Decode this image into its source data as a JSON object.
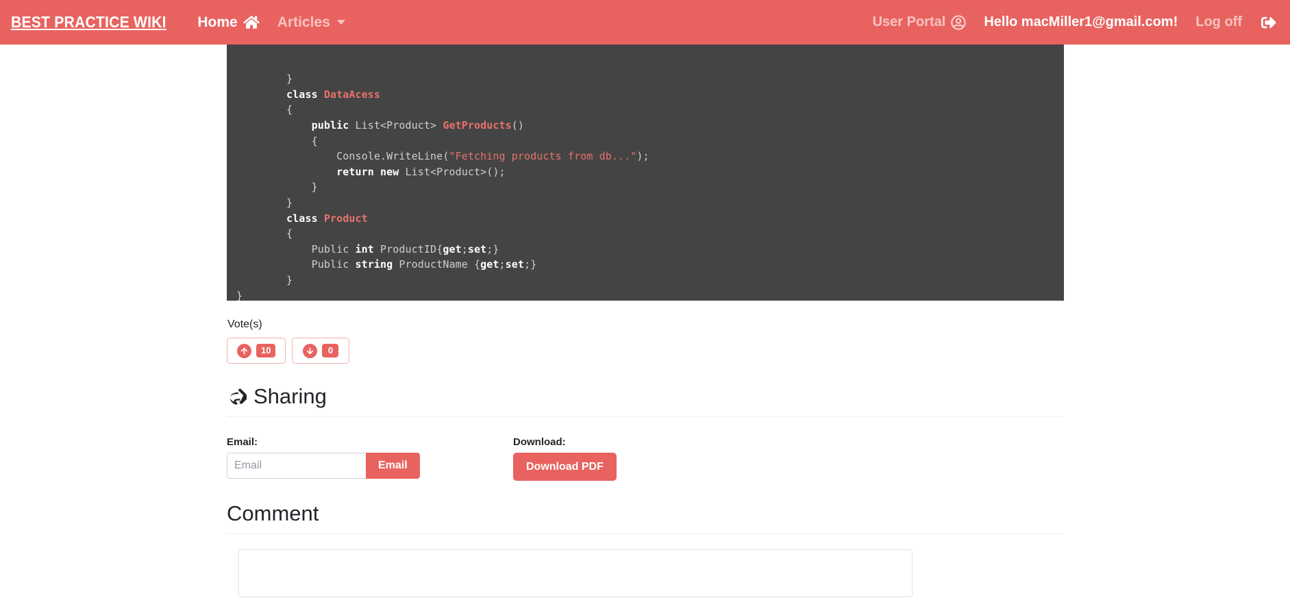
{
  "navbar": {
    "brand": "BEST PRACTICE WIKI",
    "home_label": "Home",
    "home_icon": "house-icon",
    "articles_label": "Articles",
    "articles_caret_icon": "chevron-down-icon",
    "user_portal_label": "User Portal",
    "user_portal_icon": "user-circle-icon",
    "greeting": "Hello macMiller1@gmail.com!",
    "logoff_label": "Log off",
    "logoff_icon": "sign-out-icon",
    "background_color": "#e8635f",
    "text_color": "#ffffff"
  },
  "code": {
    "language": "csharp",
    "background_color": "#444444",
    "lines": [
      "        }",
      "        class DataAcess",
      "        {",
      "            public List<Product> GetProducts()",
      "            {",
      "                Console.WriteLine(\"Fetching products from db...\");",
      "                return new List<Product>();",
      "            }",
      "        }",
      "        class Product",
      "        {",
      "            Public int ProductID{get;set;}",
      "            Public string ProductName {get;set;}",
      "        }",
      "}"
    ]
  },
  "votes": {
    "label": "Vote(s)",
    "upvote": {
      "icon": "arrow-up-icon",
      "count": "10"
    },
    "downvote": {
      "icon": "arrow-down-icon",
      "count": "0"
    },
    "accent_color": "#e8635f"
  },
  "sharing": {
    "heading": "Sharing",
    "heading_icon": "share-square-icon",
    "email_label": "Email:",
    "email_value": "",
    "email_placeholder": "Email",
    "email_button": "Email",
    "download_label": "Download:",
    "download_button": "Download PDF"
  },
  "comment": {
    "heading": "Comment",
    "textarea_value": "",
    "textarea_placeholder": ""
  }
}
